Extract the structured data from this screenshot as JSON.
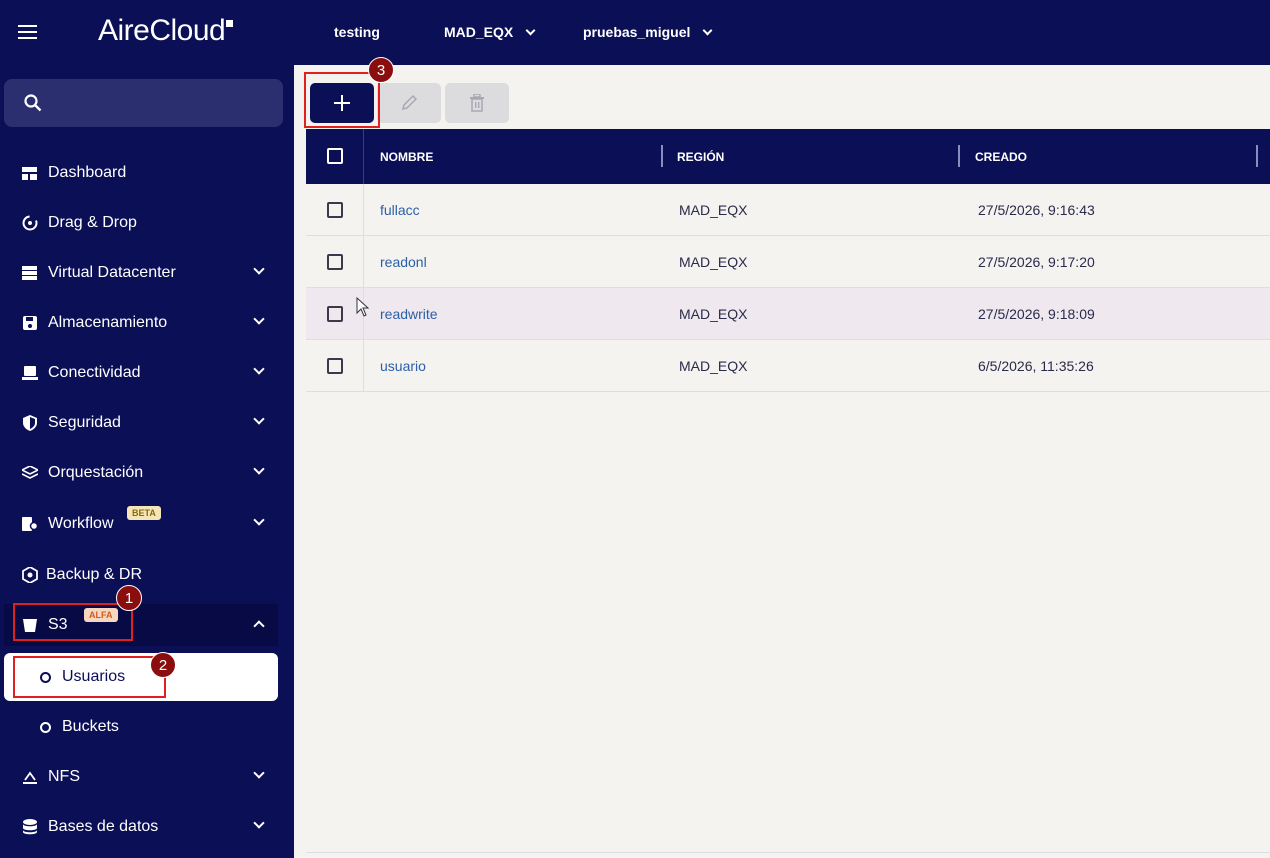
{
  "header": {
    "logo": "AireCloud",
    "items": [
      {
        "label": "testing"
      },
      {
        "label": "MAD_EQX"
      },
      {
        "label": "pruebas_miguel"
      }
    ]
  },
  "sidebar": {
    "search_placeholder": "",
    "items": [
      {
        "label": "Dashboard",
        "icon": "dashboard-icon"
      },
      {
        "label": "Drag & Drop",
        "icon": "drag-drop-icon"
      },
      {
        "label": "Virtual Datacenter",
        "icon": "server-icon"
      },
      {
        "label": "Almacenamiento",
        "icon": "save-icon"
      },
      {
        "label": "Conectividad",
        "icon": "laptop-icon"
      },
      {
        "label": "Seguridad",
        "icon": "shield-icon"
      },
      {
        "label": "Orquestación",
        "icon": "layers-icon"
      },
      {
        "label": "Workflow",
        "icon": "workflow-icon",
        "badge": "BETA"
      },
      {
        "label": "Backup & DR",
        "icon": "backup-icon"
      },
      {
        "label": "S3",
        "icon": "bucket-icon",
        "badge": "ALFA"
      },
      {
        "label": "NFS",
        "icon": "nfs-icon"
      },
      {
        "label": "Bases de datos",
        "icon": "database-icon"
      }
    ],
    "s3_sub": [
      {
        "label": "Usuarios"
      },
      {
        "label": "Buckets"
      }
    ]
  },
  "annotations": [
    "1",
    "2",
    "3"
  ],
  "table": {
    "columns": [
      "NOMBRE",
      "REGIÓN",
      "CREADO"
    ],
    "rows": [
      {
        "name": "fullacc",
        "region": "MAD_EQX",
        "created": "27/5/2026, 9:16:43"
      },
      {
        "name": "readonl",
        "region": "MAD_EQX",
        "created": "27/5/2026, 9:17:20"
      },
      {
        "name": "readwrite",
        "region": "MAD_EQX",
        "created": "27/5/2026, 9:18:09"
      },
      {
        "name": "usuario",
        "region": "MAD_EQX",
        "created": "6/5/2026, 11:35:26"
      }
    ]
  },
  "colors": {
    "primary": "#0b0f56",
    "link": "#2b5fa8",
    "annotation": "#8b0e0e"
  }
}
